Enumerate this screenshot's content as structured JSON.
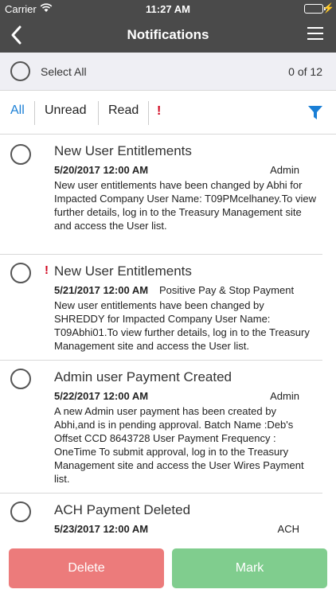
{
  "statusbar": {
    "carrier": "Carrier",
    "time": "11:27 AM"
  },
  "navbar": {
    "title": "Notifications"
  },
  "selectbar": {
    "label": "Select All",
    "count": "0 of 12"
  },
  "filters": {
    "all": "All",
    "unread": "Unread",
    "read": "Read",
    "priority": "!"
  },
  "colors": {
    "header": "#4a4a4a",
    "accent": "#1a7fd6",
    "priority": "#d0021b",
    "delete": "#ec7b7b",
    "mark": "#80cd8e"
  },
  "notifications": [
    {
      "title": "New User Entitlements",
      "date": "5/20/2017 12:00 AM",
      "category": "Admin",
      "priority": "",
      "body": "New user entitlements have been changed by Abhi for Impacted Company User Name: T09PMcelhaney.To view further details, log in to the Treasury Management site and access the User list."
    },
    {
      "title": "New User Entitlements",
      "date": "5/21/2017 12:00 AM",
      "category": "Positive Pay & Stop Payment",
      "priority": "!",
      "body": "New user entitlements have been changed by SHREDDY for Impacted Company User Name: T09Abhi01.To view further details, log in to the Treasury Management site and access the User list."
    },
    {
      "title": "Admin user Payment Created",
      "date": "5/22/2017 12:00 AM",
      "category": "Admin",
      "priority": "",
      "body": "A new Admin user payment has been created by Abhi,and is in pending approval. Batch Name :Deb's Offset CCD 8643728 User Payment Frequency : OneTime To submit approval, log in to the Treasury Management site and access the User Wires Payment list."
    },
    {
      "title": "ACH Payment Deleted",
      "date": "5/23/2017 12:00 AM",
      "category": "ACH",
      "priority": "",
      "body": ""
    }
  ],
  "actions": {
    "delete": "Delete",
    "mark": "Mark"
  }
}
